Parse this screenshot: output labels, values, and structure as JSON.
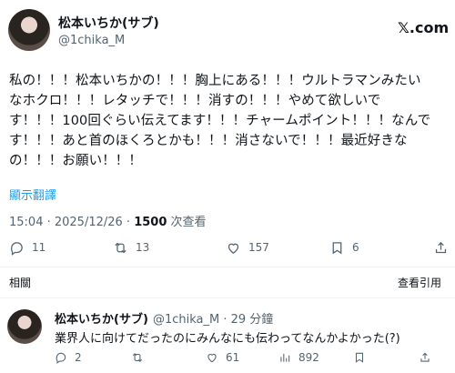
{
  "tweet": {
    "author_name": "松本いちか(サブ)",
    "author_handle": "@1chika_M",
    "source_logo": "𝕏.com",
    "lines": [
      "私の！！！松本いちかの！！！胸上にある！！！ウルトラマンみたい",
      "なホクロ！！！レタッチで！！！消すの！！！やめて欲しいで",
      "す！！！100回ぐらい伝えてます！！！チャームポイント！！！なんで",
      "す！！！あと首のほくろとかも！！！消さないで！！！最近好きな",
      "の！！！お願い！！！"
    ],
    "translate_label": "顯示翻譯",
    "time_date": "15:04 · 2025/12/26 · ",
    "views_count": "1500",
    "views_label": " 次查看",
    "actions": {
      "replies": "11",
      "reposts": "13",
      "likes": "157",
      "bookmarks": "6"
    },
    "icons": [
      "reply-icon",
      "repost-icon",
      "like-icon",
      "bookmark-icon",
      "share-icon"
    ]
  },
  "replies_section": {
    "label": "相關",
    "sort_label": "查看引用"
  },
  "reply": {
    "author_name": "松本いちか(サブ)",
    "meta": "@1chika_M · 29 分鐘",
    "text": "業界人に向けてだったのにみんなにも伝わってなんかよかった(?)",
    "actions": {
      "replies": "2",
      "likes": "61",
      "views": "892"
    }
  },
  "colors": {
    "link": "#1d9bf0",
    "secondary_text": "#536471",
    "primary_text": "#0f1419",
    "divider": "#eff3f4"
  }
}
